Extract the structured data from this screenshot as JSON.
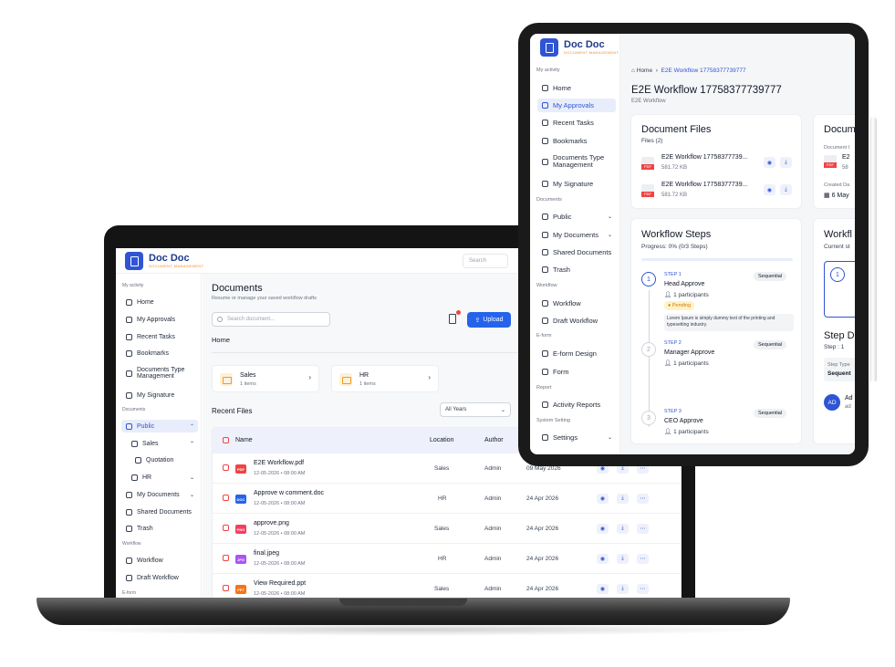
{
  "brand": {
    "name": "Doc Doc",
    "tagline": "DOCUMENT MANAGEMENT",
    "color": "#2f55d4",
    "accent": "#f08a24"
  },
  "laptop": {
    "search_placeholder": "Search",
    "sidebar": {
      "sections": [
        "My activity",
        "Documents",
        "Workflow",
        "E-form"
      ],
      "items": [
        {
          "label": "Home",
          "icon": "home-icon"
        },
        {
          "label": "My Approvals",
          "icon": "approval-icon"
        },
        {
          "label": "Recent Tasks",
          "icon": "clock-icon"
        },
        {
          "label": "Bookmarks",
          "icon": "bookmark-icon"
        },
        {
          "label": "Documents Type Management",
          "icon": "document-type-icon"
        },
        {
          "label": "My Signature",
          "icon": "signature-icon"
        },
        {
          "label": "Public",
          "icon": "folder-icon"
        },
        {
          "label": "Sales",
          "icon": "folder-icon"
        },
        {
          "label": "Quotation",
          "icon": "folder-icon"
        },
        {
          "label": "HR",
          "icon": "folder-icon"
        },
        {
          "label": "My Documents",
          "icon": "folder-icon"
        },
        {
          "label": "Shared Documents",
          "icon": "share-icon"
        },
        {
          "label": "Trash",
          "icon": "trash-icon"
        },
        {
          "label": "Workflow",
          "icon": "workflow-icon"
        },
        {
          "label": "Draft Workflow",
          "icon": "draft-icon"
        }
      ]
    },
    "main": {
      "title": "Documents",
      "subtitle": "Resume or manage your saved workflow drafts",
      "search_placeholder": "Search document...",
      "upload_label": "Upload",
      "breadcrumb": "Home",
      "folders": [
        {
          "name": "Sales",
          "count": "1 items"
        },
        {
          "name": "HR",
          "count": "1 items"
        }
      ],
      "recent_label": "Recent Files",
      "filter_value": "All Years",
      "columns": [
        "Name",
        "Location",
        "Author"
      ],
      "rows": [
        {
          "type": "PDF",
          "type_color": "#ef4444",
          "name": "E2E Workflow.pdf",
          "date": "12-05-2026  •  08:00 AM",
          "location": "Sales",
          "author": "Admin",
          "modified": "09 May 2026"
        },
        {
          "type": "DOC",
          "type_color": "#2563eb",
          "name": "Approve w comment.doc",
          "date": "12-05-2026  •  08:00 AM",
          "location": "HR",
          "author": "Admin",
          "modified": "24 Apr 2026"
        },
        {
          "type": "PNG",
          "type_color": "#f43f5e",
          "name": "approve.png",
          "date": "12-05-2026  •  08:00 AM",
          "location": "Sales",
          "author": "Admin",
          "modified": "24 Apr 2026"
        },
        {
          "type": "JPG",
          "type_color": "#a855f7",
          "name": "final.jpeg",
          "date": "12-05-2026  •  08:00 AM",
          "location": "HR",
          "author": "Admin",
          "modified": "24 Apr 2026"
        },
        {
          "type": "PPT",
          "type_color": "#f97316",
          "name": "View Required.ppt",
          "date": "12-05-2026  •  08:00 AM",
          "location": "Sales",
          "author": "Admin",
          "modified": "24 Apr 2026"
        }
      ]
    }
  },
  "tablet": {
    "sidebar": {
      "sections": [
        "My activity",
        "Documents",
        "Workflow",
        "E-form",
        "Report",
        "System Setting"
      ],
      "items": [
        {
          "label": "Home"
        },
        {
          "label": "My Approvals"
        },
        {
          "label": "Recent Tasks"
        },
        {
          "label": "Bookmarks"
        },
        {
          "label": "Documents Type Management"
        },
        {
          "label": "My Signature"
        },
        {
          "label": "Public"
        },
        {
          "label": "My Documents"
        },
        {
          "label": "Shared Documents"
        },
        {
          "label": "Trash"
        },
        {
          "label": "Workflow"
        },
        {
          "label": "Draft Workflow"
        },
        {
          "label": "E-form Design"
        },
        {
          "label": "Form"
        },
        {
          "label": "Activity Reports"
        },
        {
          "label": "Settings"
        }
      ]
    },
    "breadcrumb": {
      "home": "Home",
      "current": "E2E Workflow 17758377739777"
    },
    "title": "E2E Workflow 17758377739777",
    "subtitle": "E2E Workflow",
    "files_card": {
      "title": "Document Files",
      "count": "Files (2)",
      "files": [
        {
          "name": "E2E Workflow 17758377739...",
          "size": "581.72 KB",
          "type": "PDF"
        },
        {
          "name": "E2E Workflow 17758377739...",
          "size": "581.72 KB",
          "type": "PDF"
        }
      ]
    },
    "doc_card": {
      "title": "Docum",
      "label1": "Document I",
      "value1": "E2",
      "value1b": "58",
      "label2": "Created Da",
      "value2": "6 May"
    },
    "steps_card": {
      "title": "Workflow Steps",
      "progress": "Progress: 0% (0/3 Steps)",
      "progress_value": 0,
      "steps": [
        {
          "num": "1",
          "label": "STEP 1",
          "name": "Head Approve",
          "participants": "1 participants",
          "badge": "Sequential",
          "status": "Pending",
          "note": "Lorem Ipsum is simply dummy text of the printing and typesetting industry."
        },
        {
          "num": "2",
          "label": "STEP 2",
          "name": "Manager Approve",
          "participants": "1 participants",
          "badge": "Sequential"
        },
        {
          "num": "3",
          "label": "STEP 3",
          "name": "CEO Approve",
          "participants": "1 participants",
          "badge": "Sequential"
        }
      ]
    },
    "side_card": {
      "title": "Workfl",
      "sub": "Current st",
      "step_num": "1",
      "stepd": "Step D",
      "step_colon": "Step : 1",
      "step_type_label": "Step Type",
      "step_type_value": "Sequent",
      "avatar": "AD",
      "avatar_text": "Ad",
      "avatar_sub": "ad"
    }
  }
}
